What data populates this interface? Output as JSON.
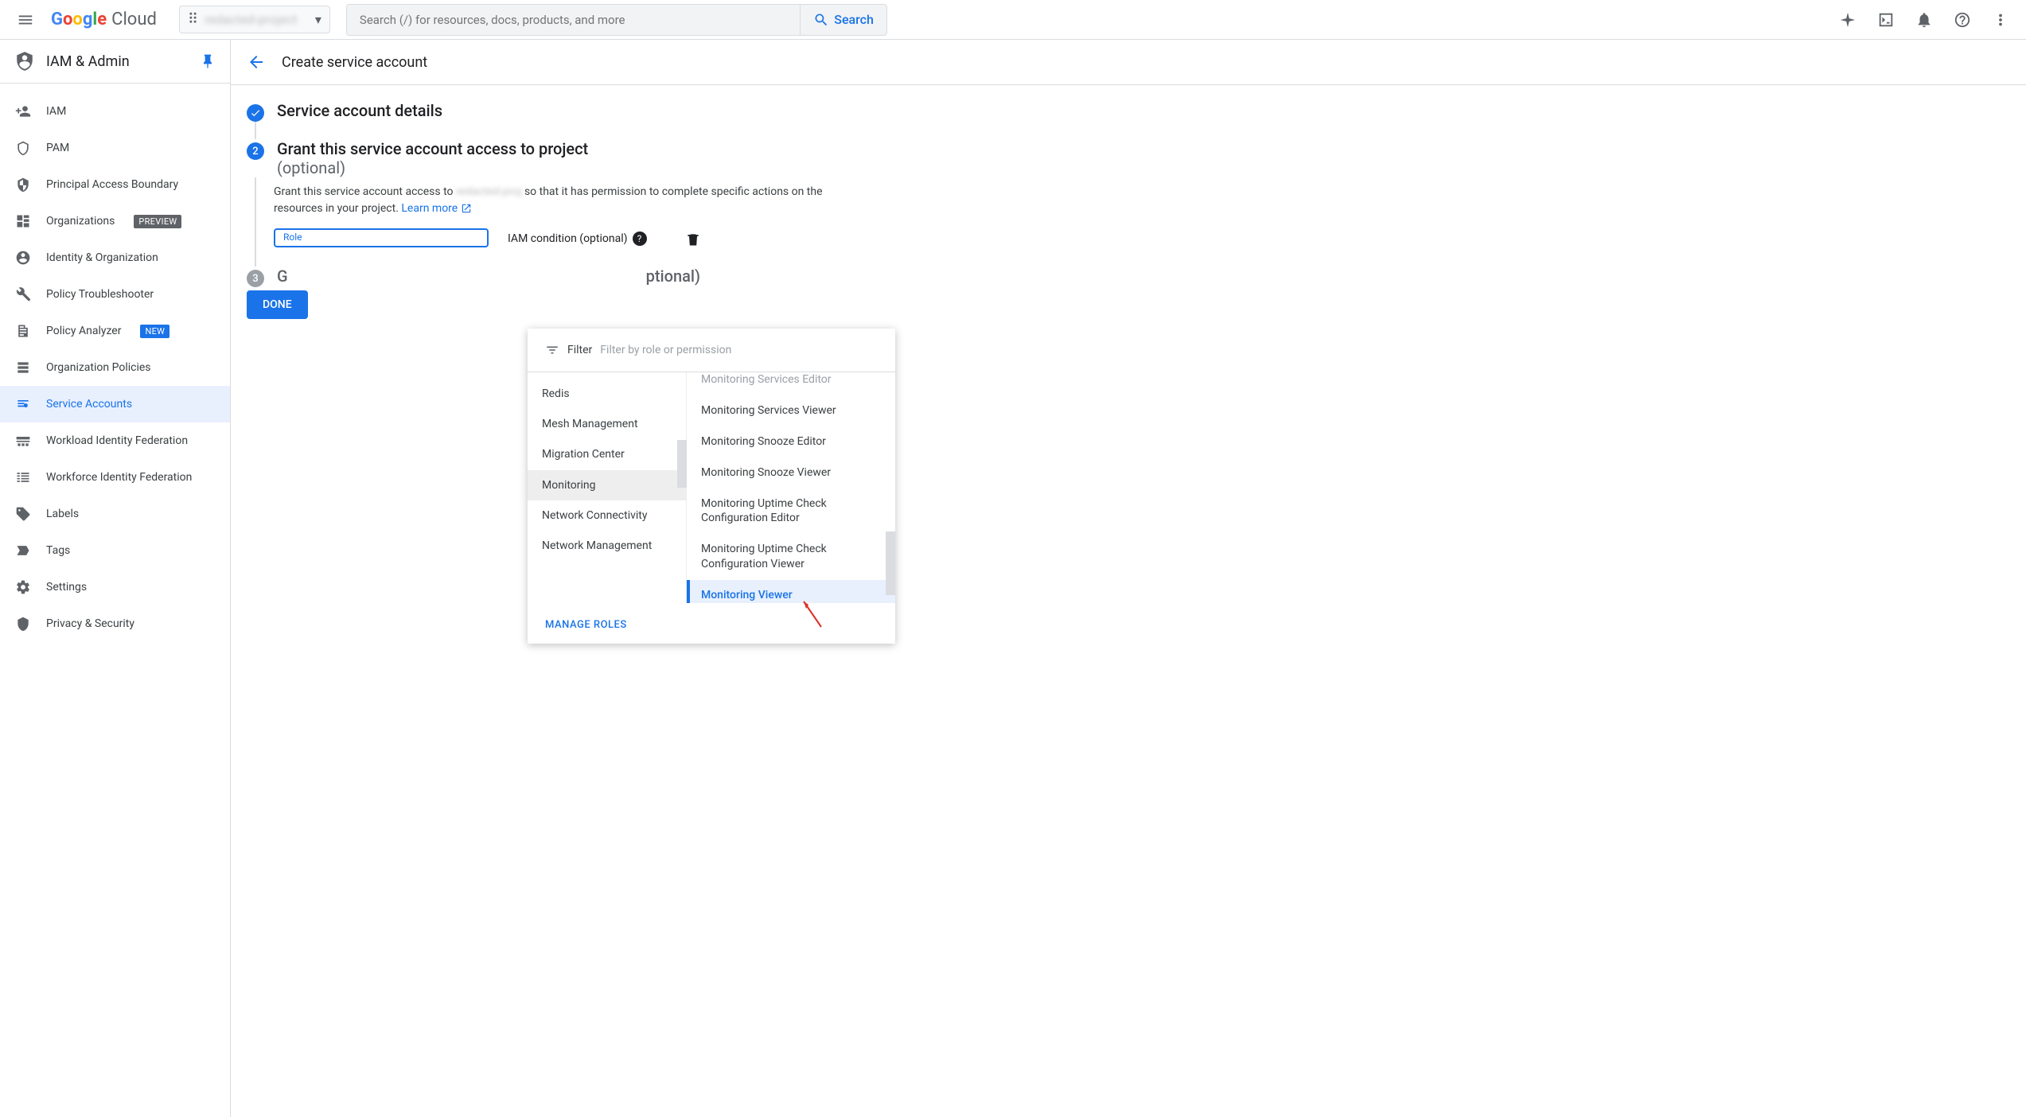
{
  "header": {
    "logo_brand": "Google",
    "logo_product": "Cloud",
    "project_name": "redacted-project",
    "search_placeholder": "Search (/) for resources, docs, products, and more",
    "search_button": "Search"
  },
  "sidebar": {
    "title": "IAM & Admin",
    "items": [
      {
        "label": "IAM",
        "icon": "person-add"
      },
      {
        "label": "PAM",
        "icon": "shield-outline"
      },
      {
        "label": "Principal Access Boundary",
        "icon": "boundary"
      },
      {
        "label": "Organizations",
        "icon": "org",
        "badge": "PREVIEW"
      },
      {
        "label": "Identity & Organization",
        "icon": "account"
      },
      {
        "label": "Policy Troubleshooter",
        "icon": "wrench"
      },
      {
        "label": "Policy Analyzer",
        "icon": "analyzer",
        "badge": "NEW"
      },
      {
        "label": "Organization Policies",
        "icon": "policy"
      },
      {
        "label": "Service Accounts",
        "icon": "service-account",
        "selected": true
      },
      {
        "label": "Workload Identity Federation",
        "icon": "workload"
      },
      {
        "label": "Workforce Identity Federation",
        "icon": "workforce"
      },
      {
        "label": "Labels",
        "icon": "tag"
      },
      {
        "label": "Tags",
        "icon": "label-tag"
      },
      {
        "label": "Settings",
        "icon": "gear"
      },
      {
        "label": "Privacy & Security",
        "icon": "privacy"
      }
    ]
  },
  "page": {
    "title": "Create service account",
    "step1_title": "Service account details",
    "step2_title": "Grant this service account access to project",
    "step2_optional": "(optional)",
    "step2_desc_a": "Grant this service account access to ",
    "step2_desc_redacted": "redacted-proj",
    "step2_desc_b": " so that it has permission to complete specific actions on the resources in your project. ",
    "step2_learn": "Learn more",
    "step3_title_a": "G",
    "step3_title_b": "ptional)",
    "role_label": "Role",
    "condition_label": "IAM condition (optional)",
    "done_label": "DONE"
  },
  "role_panel": {
    "filter_label": "Filter",
    "filter_placeholder": "Filter by role or permission",
    "categories": [
      {
        "label": "Redis"
      },
      {
        "label": "Mesh Management"
      },
      {
        "label": "Migration Center"
      },
      {
        "label": "Monitoring",
        "selected": true
      },
      {
        "label": "Network Connectivity"
      },
      {
        "label": "Network Management"
      }
    ],
    "options": [
      {
        "label": "Monitoring Services Editor",
        "cutoff": true
      },
      {
        "label": "Monitoring Services Viewer"
      },
      {
        "label": "Monitoring Snooze Editor"
      },
      {
        "label": "Monitoring Snooze Viewer"
      },
      {
        "label": "Monitoring Uptime Check Configuration Editor"
      },
      {
        "label": "Monitoring Uptime Check Configuration Viewer"
      },
      {
        "label": "Monitoring Viewer",
        "selected": true
      }
    ],
    "manage_roles": "MANAGE ROLES"
  }
}
